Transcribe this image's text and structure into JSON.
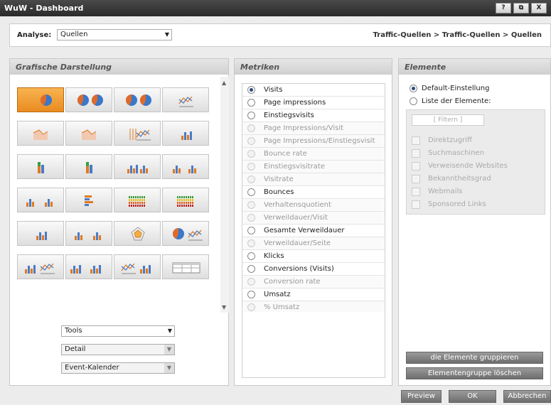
{
  "window": {
    "title": "WuW - Dashboard",
    "btn_help": "?",
    "btn_restore": "⧉",
    "btn_close": "X"
  },
  "topbar": {
    "analyse_label": "Analyse:",
    "analyse_value": "Quellen",
    "breadcrumb": "Traffic-Quellen > Traffic-Quellen > Quellen"
  },
  "graph": {
    "title": "Grafische Darstellung",
    "scroll_up": "▲",
    "scroll_down": "▼",
    "dropdowns": [
      {
        "value": "Tools",
        "enabled": true
      },
      {
        "value": "Detail",
        "enabled": false
      },
      {
        "value": "Event-Kalender",
        "enabled": false
      }
    ]
  },
  "metriken": {
    "title": "Metriken",
    "items": [
      {
        "label": "Visits",
        "enabled": true,
        "selected": true
      },
      {
        "label": "Page impressions",
        "enabled": true
      },
      {
        "label": "Einstiegsvisits",
        "enabled": true
      },
      {
        "label": "Page Impressions/Visit",
        "enabled": false
      },
      {
        "label": "Page Impressions/Einstiegsvisit",
        "enabled": false
      },
      {
        "label": "Bounce rate",
        "enabled": false
      },
      {
        "label": "Einstiegsvisitrate",
        "enabled": false
      },
      {
        "label": "Visitrate",
        "enabled": false
      },
      {
        "label": "Bounces",
        "enabled": true
      },
      {
        "label": "Verhaltensquotient",
        "enabled": false
      },
      {
        "label": "Verweildauer/Visit",
        "enabled": false
      },
      {
        "label": "Gesamte Verweildauer",
        "enabled": true
      },
      {
        "label": "Verweildauer/Seite",
        "enabled": false
      },
      {
        "label": "Klicks",
        "enabled": true
      },
      {
        "label": "Conversions (Visits)",
        "enabled": true
      },
      {
        "label": "Conversion rate",
        "enabled": false
      },
      {
        "label": "Umsatz",
        "enabled": true
      },
      {
        "label": "% Umsatz",
        "enabled": false
      }
    ]
  },
  "elemente": {
    "title": "Elemente",
    "radio_default": "Default-Einstellung",
    "radio_list": "Liste der Elemente:",
    "filter_placeholder": "[ Filtern ]",
    "items": [
      "Direktzugriff",
      "Suchmaschinen",
      "Verweisende Websites",
      "Bekanntheitsgrad",
      "Webmails",
      "Sponsored Links"
    ],
    "btn_group": "die Elemente gruppieren",
    "btn_delete": "Elementengruppe löschen"
  },
  "footer": {
    "preview": "Preview",
    "ok": "OK",
    "cancel": "Abbrechen"
  },
  "colors": {
    "selected_chart": "#f0a030",
    "pie_orange": "#e06a2a",
    "pie_blue": "#3a78c8",
    "bar_orange": "#e07a20",
    "bar_blue": "#4a7ac8",
    "bar_green": "#3aa040"
  }
}
